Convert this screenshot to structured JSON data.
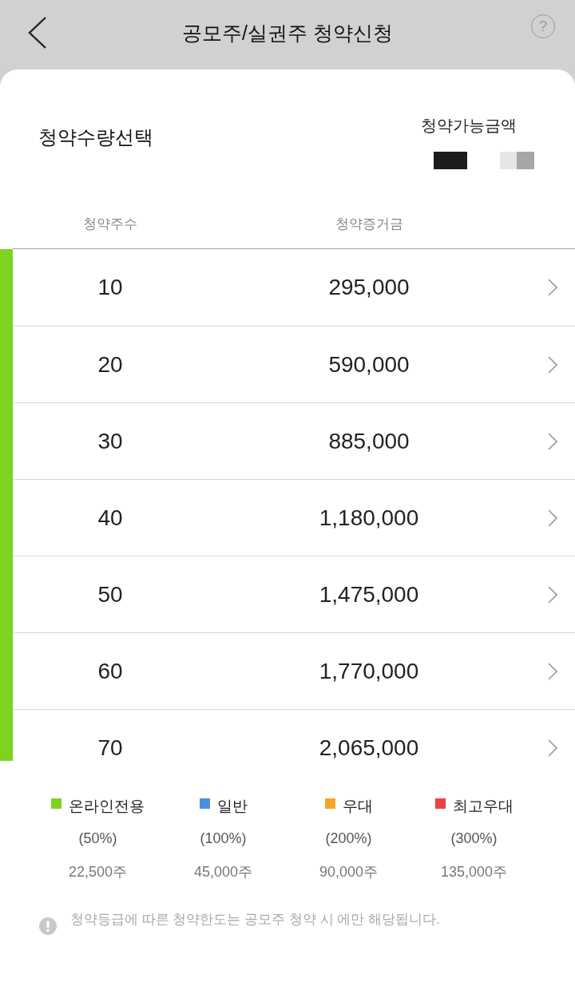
{
  "header": {
    "title": "공모주/실권주 청약신청",
    "help": "?"
  },
  "summary": {
    "title": "청약수량선택",
    "available_label": "청약가능금액"
  },
  "table": {
    "columns": [
      "청약주수",
      "청약증거금"
    ],
    "rows": [
      {
        "shares": "10",
        "deposit": "295,000",
        "color": "#7ed321"
      },
      {
        "shares": "20",
        "deposit": "590,000",
        "color": "#7ed321"
      },
      {
        "shares": "30",
        "deposit": "885,000",
        "color": "#7ed321"
      },
      {
        "shares": "40",
        "deposit": "1,180,000",
        "color": "#7ed321"
      },
      {
        "shares": "50",
        "deposit": "1,475,000",
        "color": "#7ed321"
      },
      {
        "shares": "60",
        "deposit": "1,770,000",
        "color": "#7ed321"
      },
      {
        "shares": "70",
        "deposit": "2,065,000",
        "color": "#7ed321"
      }
    ]
  },
  "legend": [
    {
      "label": "온라인전용",
      "color": "#7ed321",
      "ratio": "(50%)",
      "limit": "22,500주"
    },
    {
      "label": "일반",
      "color": "#4a90e2",
      "ratio": "(100%)",
      "limit": "45,000주"
    },
    {
      "label": "우대",
      "color": "#f5a623",
      "ratio": "(200%)",
      "limit": "90,000주"
    },
    {
      "label": "최고우대",
      "color": "#e94343",
      "ratio": "(300%)",
      "limit": "135,000주"
    }
  ],
  "notice": "청약등급에 따른 청약한도는 공모주 청약 시 에만 해당됩니다."
}
